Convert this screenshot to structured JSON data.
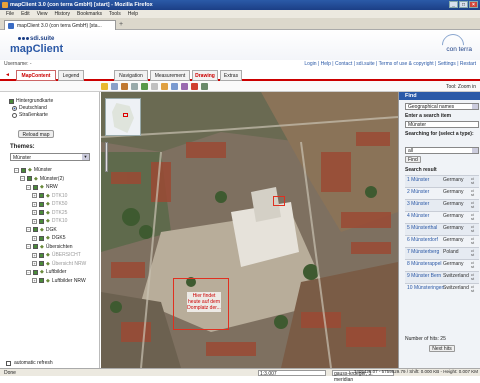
{
  "window": {
    "title": "mapClient 3.0 (con terra GmbH) [start] - Mozilla Firefox"
  },
  "menu": [
    "File",
    "Edit",
    "View",
    "History",
    "Bookmarks",
    "Tools",
    "Help"
  ],
  "browser_tab": {
    "label": "mapClient 3.0 (con terra GmbH) [sta..."
  },
  "header": {
    "small_brand": "sdi.suite",
    "app_title": "mapClient",
    "logo_text": "con terra"
  },
  "userbar": {
    "username": "Username: -",
    "links": "Login | Help | Contact | sdi.suite | Terms of use & copyright | Settings | Restart"
  },
  "tabs": [
    "MapContent",
    "Legend",
    "Navigation",
    "Measurement",
    "Drawing",
    "Extras"
  ],
  "toolbar": {
    "tool_info": "Tool: Zoom in"
  },
  "layers": {
    "checkbox": "Hintergrundkarte",
    "radios": [
      "Deutschland",
      "Straßenkarte"
    ],
    "reload": "Reload map"
  },
  "themes": {
    "title": "Themes:",
    "selected": "Münster"
  },
  "tree": [
    {
      "label": "Münster",
      "indent": 0,
      "gray": false
    },
    {
      "label": "Münster(2)",
      "indent": 1,
      "gray": false
    },
    {
      "label": "NRW",
      "indent": 2,
      "gray": false
    },
    {
      "label": "DTK10",
      "indent": 3,
      "gray": true
    },
    {
      "label": "DTK50",
      "indent": 3,
      "gray": true
    },
    {
      "label": "DTK25",
      "indent": 3,
      "gray": true
    },
    {
      "label": "DTK10",
      "indent": 3,
      "gray": true
    },
    {
      "label": "DGK",
      "indent": 2,
      "gray": false
    },
    {
      "label": "DGK5",
      "indent": 3,
      "gray": false
    },
    {
      "label": "Übersichten",
      "indent": 2,
      "gray": false
    },
    {
      "label": "ÜBERSICHT",
      "indent": 3,
      "gray": true
    },
    {
      "label": "Übersicht NRW",
      "indent": 3,
      "gray": true
    },
    {
      "label": "Luftbilder",
      "indent": 2,
      "gray": false
    },
    {
      "label": "Luftbilder NRW",
      "indent": 3,
      "gray": false
    }
  ],
  "auto_refresh": "automatic refresh",
  "map": {
    "label_text": "Hier findet heute auf dem Domplatz der..."
  },
  "find": {
    "title": "Find",
    "source": "Geographical names",
    "enter_label": "Enter a search item",
    "search_value": "Münster",
    "type_label": "Searching for (select a type):",
    "type_value": "all",
    "find_button": "Find",
    "result_title": "Search result",
    "results": [
      {
        "num": "1",
        "name": "Münster",
        "country": "Germany",
        "info": "ci st"
      },
      {
        "num": "2",
        "name": "Münster",
        "country": "Germany",
        "info": "ci st"
      },
      {
        "num": "3",
        "name": "Münster",
        "country": "Germany",
        "info": "ci st"
      },
      {
        "num": "4",
        "name": "Münster",
        "country": "Germany",
        "info": "ci st"
      },
      {
        "num": "5",
        "name": "Münsterthal",
        "country": "Germany",
        "info": "ci st"
      },
      {
        "num": "6",
        "name": "Münsterdorf",
        "country": "Germany",
        "info": "ci st"
      },
      {
        "num": "7",
        "name": "Münsterberg",
        "country": "Poland",
        "info": "ci st"
      },
      {
        "num": "8",
        "name": "Münsterappel",
        "country": "Germany",
        "info": "ci st"
      },
      {
        "num": "9",
        "name": "Münster Bern",
        "country": "Switzerland",
        "info": "ci st"
      },
      {
        "num": "10",
        "name": "Münsteringen",
        "country": "Switzerland",
        "info": "ci st"
      }
    ],
    "hits": "Number of hits: 25",
    "next": "Next hits"
  },
  "status": {
    "left": "Done",
    "scale": "1:3.007",
    "projection": "gauss-krueger, 3. meridian",
    "coords": "3405425.07 - 5759629.79 / Shift: 0.000 KB - Height: 0.007 KM"
  }
}
